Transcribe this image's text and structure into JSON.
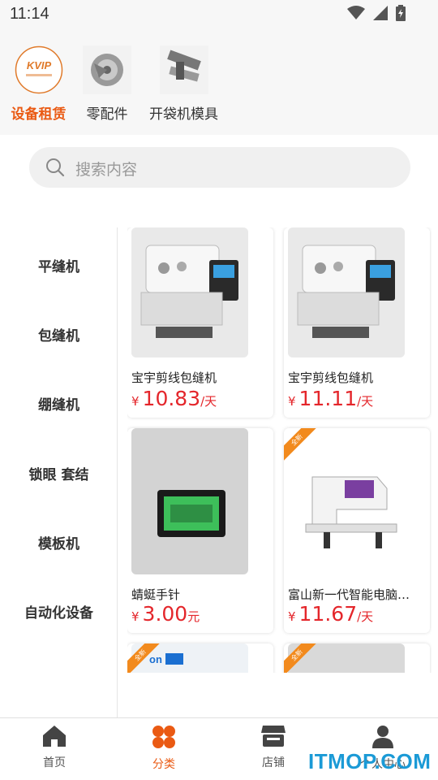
{
  "status": {
    "time": "11:14"
  },
  "top_categories": [
    {
      "label": "设备租赁",
      "logo_text": "KVIP",
      "active": true
    },
    {
      "label": "零配件",
      "active": false
    },
    {
      "label": "开袋机模具",
      "active": false
    }
  ],
  "search": {
    "placeholder": "搜索内容"
  },
  "sidebar": {
    "items": [
      {
        "label": "平缝机"
      },
      {
        "label": "包缝机"
      },
      {
        "label": "绷缝机"
      },
      {
        "label": "锁眼 套结"
      },
      {
        "label": "模板机"
      },
      {
        "label": "自动化设备"
      }
    ]
  },
  "products": [
    {
      "title": "宝宇剪线包缝机",
      "currency": "¥",
      "price": "10.83",
      "unit": "/天"
    },
    {
      "title": "宝宇剪线包缝机",
      "currency": "¥",
      "price": "11.11",
      "unit": "/天"
    },
    {
      "title": "蜻蜓手针",
      "currency": "¥",
      "price": "3.00",
      "unit": "元"
    },
    {
      "title": "富山新一代智能电脑…",
      "currency": "¥",
      "price": "11.67",
      "unit": "/天",
      "badge": "全新"
    },
    {
      "badge": "全新"
    },
    {
      "badge": "全新"
    }
  ],
  "tabs": [
    {
      "label": "首页",
      "icon": "home-icon"
    },
    {
      "label": "分类",
      "icon": "category-icon",
      "active": true
    },
    {
      "label": "店铺",
      "icon": "store-icon"
    },
    {
      "label": "个人中心",
      "icon": "user-icon"
    }
  ],
  "watermark": "ITMOP.COM",
  "colors": {
    "accent": "#ea5a13",
    "price": "#e4262b",
    "ribbon": "#f28a1d"
  }
}
